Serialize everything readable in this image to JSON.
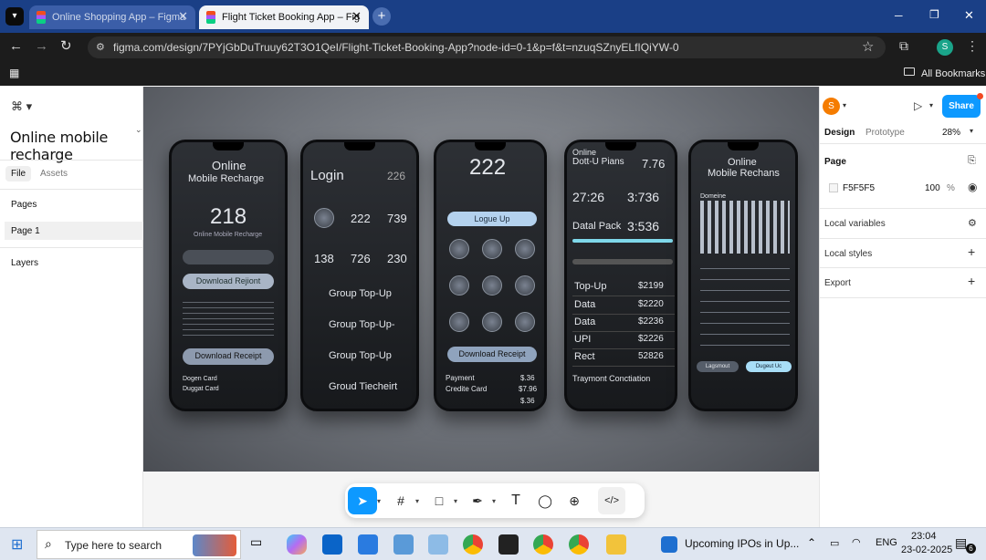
{
  "browser": {
    "tabs": [
      {
        "label": "Online Shopping App – Figma",
        "close": "✕"
      },
      {
        "label": "Flight Ticket Booking App – Fig",
        "close": "✕"
      }
    ],
    "new_tab": "+",
    "url": "figma.com/design/7PYjGbDuTruuy62T3O1QeI/Flight-Ticket-Booking-App?node-id=0-1&p=f&t=nzuqSZnyELfIQiYW-0",
    "profile_initial": "S",
    "bookmarks_label": "All Bookmarks",
    "window": {
      "min": "─",
      "max": "❐",
      "close": "✕"
    }
  },
  "left_panel": {
    "file_name": "Online mobile recharge",
    "tabs": [
      "File",
      "Assets"
    ],
    "pages_heading": "Pages",
    "page_item": "Page 1",
    "layers_heading": "Layers"
  },
  "right_panel": {
    "avatar_initial": "S",
    "share_label": "Share",
    "tabs": [
      "Design",
      "Prototype"
    ],
    "zoom": "28%",
    "page_heading": "Page",
    "page_color_hex": "F5F5F5",
    "page_opacity": "100",
    "percent": "%",
    "local_variables": "Local variables",
    "local_styles": "Local styles",
    "export": "Export",
    "plus": "+"
  },
  "artwork": {
    "p1": {
      "title1": "Online",
      "title2": "Mobile Recharge",
      "number": "218",
      "caption": "Online Mobile Recharge",
      "btn1": "Download Rejiont",
      "btn2": "Download Receipt",
      "foot1": "Dogen Card",
      "foot2": "Duggat Card"
    },
    "p2": {
      "title": "Login",
      "corner": "226",
      "nums": [
        "222",
        "739",
        "138",
        "726",
        "230"
      ],
      "rows": [
        "Group Top-Up",
        "Group Top-Up-",
        "Group Top-Up",
        "Groud Tiecheirt"
      ]
    },
    "p3": {
      "big": "222",
      "pill": "Logue Up",
      "btn": "Download Receipt",
      "rows": [
        [
          "Payment",
          "$.36"
        ],
        [
          "Credite Card",
          "$7.96"
        ]
      ],
      "last": "$.36"
    },
    "p4": {
      "title1": "Online",
      "title2": "Dott-U Pians",
      "t2val": "7.76",
      "time1": "27:26",
      "time2": "3:736",
      "dataPack": "Datal Pack",
      "dpval": "3:536",
      "rows": [
        [
          "Top-Up",
          "$2199"
        ],
        [
          "Data",
          "$2220"
        ],
        [
          "Data",
          "$2236"
        ],
        [
          "UPI",
          "$2226"
        ],
        [
          "Rect",
          "52826"
        ]
      ],
      "foot": "Traymont Conctiation"
    },
    "p5": {
      "title1": "Online",
      "title2": "Mobile Rechans",
      "label": "Domeine",
      "btnL": "Lagsmout",
      "btnR": "Dugeut Uc"
    }
  },
  "taskbar": {
    "search_placeholder": "Type here to search",
    "news": "Upcoming IPOs in Up...",
    "lang": "ENG",
    "time": "23:04",
    "date": "23-02-2025",
    "notif_count": "6"
  },
  "help_label": "?",
  "colors": {
    "share": "#0d99ff",
    "accent_tab_bar": "#1a3f86",
    "avatar": "#f57c00"
  }
}
